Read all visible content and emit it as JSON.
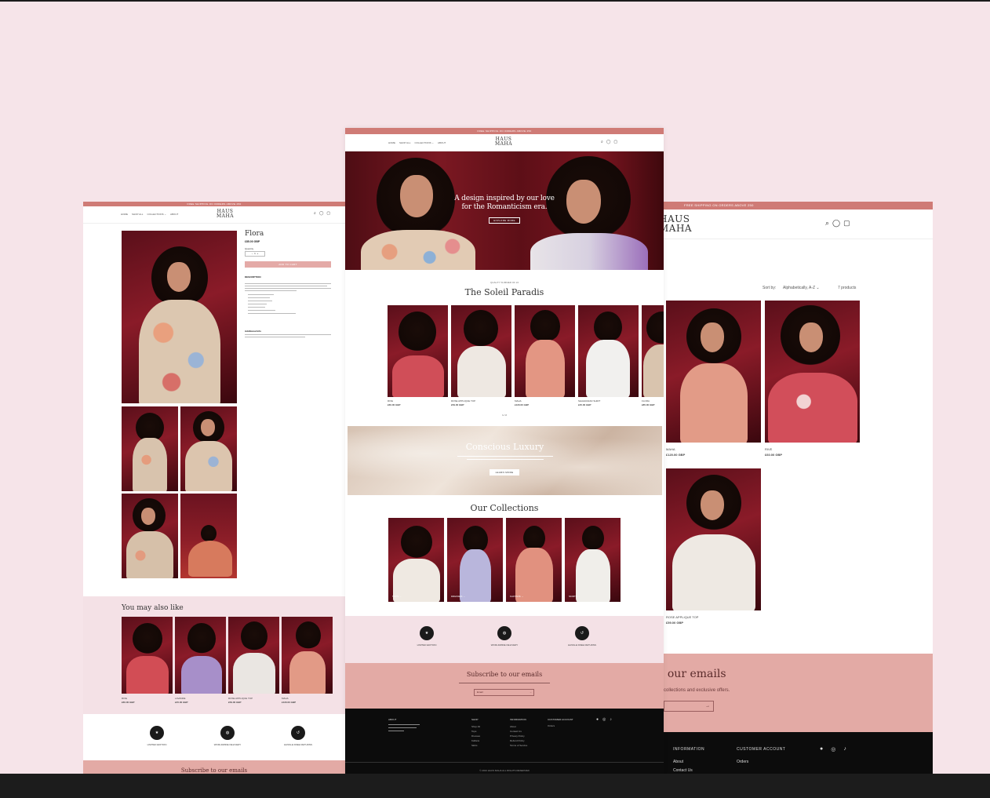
{
  "announcement": "FREE SHIPPING ON ORDERS ABOVE 250",
  "brand": {
    "line1": "HAUS",
    "line2": "MAHA"
  },
  "nav": [
    "HOME",
    "SHOP ALL",
    "COLLECTIONS ⌄",
    "ABOUT"
  ],
  "icons": {
    "search": "search-icon",
    "account": "user-icon",
    "cart": "bag-icon"
  },
  "left": {
    "product_title": "Flora",
    "price": "£85.00 GBP",
    "quantity_label": "Quantity",
    "quantity_value": "1",
    "add_to_cart": "ADD TO CART",
    "description_heading": "DESCRIPTION",
    "additional_heading": "Additional Info",
    "also_like": "You may also like",
    "also_like_items": [
      {
        "name": "RIVE",
        "price": "£60.00 GBP"
      },
      {
        "name": "LAVANDE",
        "price": "£45.00 GBP"
      },
      {
        "name": "ROSE APPLIQUE TOP",
        "price": "£59.00 GBP"
      },
      {
        "name": "MAHA",
        "price": "£120.00 GBP"
      }
    ],
    "features": [
      "LIMITED EDITION",
      "WORLDWIDE DELIVERY",
      "HASSLE FREE RETURNS"
    ],
    "subscribe": "Subscribe to our emails"
  },
  "center": {
    "hero_title_1": "A design inspired by our love",
    "hero_title_2": "for the Romanticism era.",
    "hero_button": "EXPLORE MORE",
    "kicker": "QUALITY SUMMER OF 24",
    "collection_title": "The Soleil Paradis",
    "carousel": [
      {
        "name": "RIVE",
        "price": "£60.00 GBP"
      },
      {
        "name": "ROSE APPLIQUE TOP",
        "price": "£59.00 GBP"
      },
      {
        "name": "MAHA",
        "price": "£120.00 GBP"
      },
      {
        "name": "SHAHRAZAD SHIRT",
        "price": "£45.00 GBP"
      },
      {
        "name": "FLORA",
        "price": "£85.00 GBP"
      }
    ],
    "pager": "1 / 2",
    "luxury_title": "Conscious Luxury",
    "luxury_button": "LEARN MORE",
    "collections_title": "Our Collections",
    "collections": [
      "TOPS →",
      "DRESSES →",
      "KAFTANS →",
      "SKIRTS →"
    ],
    "features": [
      "LIMITED EDITION",
      "WORLDWIDE DELIVERY",
      "HASSLE FREE RETURNS"
    ],
    "subscribe": "Subscribe to our emails",
    "email_placeholder": "Email",
    "footer_cols": [
      "ABOUT",
      "SHOP",
      "INFORMATION",
      "CUSTOMER ACCOUNT"
    ],
    "footer_shop": [
      "Shop All",
      "Tops",
      "Dresses",
      "Kaftans",
      "Skirts"
    ],
    "footer_info": [
      "About",
      "Contact Us",
      "Privacy Policy",
      "Refund Policy",
      "Terms of Service"
    ],
    "footer_account": [
      "Orders"
    ],
    "copyright": "© 2024 HAUS MAHA ALL RIGHTS RESERVED"
  },
  "right": {
    "sort_label": "Sort by:",
    "sort_value": "Alphabetically, A-Z ⌄",
    "count": "7 products",
    "products": [
      {
        "name": "MAHA",
        "price": "£120.00 GBP"
      },
      {
        "name": "RIVE",
        "price": "£60.00 GBP"
      },
      {
        "name": "ROSE APPLIQUE TOP",
        "price": "£59.00 GBP"
      }
    ],
    "subscribe": "o our emails",
    "subscribe_sub": "collections and exclusive offers.",
    "footer_info": "INFORMATION",
    "footer_account": "CUSTOMER ACCOUNT",
    "footer_about": "About",
    "footer_contact": "Contact Us",
    "footer_orders": "Orders"
  }
}
